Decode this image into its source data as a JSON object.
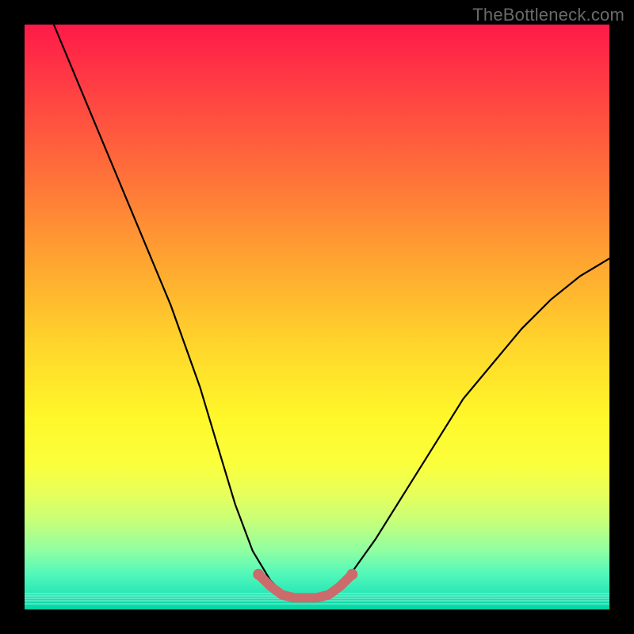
{
  "watermark": "TheBottleneck.com",
  "chart_data": {
    "type": "line",
    "title": "",
    "xlabel": "",
    "ylabel": "",
    "xlim": [
      0,
      100
    ],
    "ylim": [
      0,
      100
    ],
    "grid": false,
    "legend": "none",
    "series": [
      {
        "name": "bottleneck-curve",
        "color": "#000000",
        "x": [
          5,
          10,
          15,
          20,
          25,
          30,
          33,
          36,
          39,
          42,
          44,
          46,
          48,
          50,
          52,
          55,
          60,
          65,
          70,
          75,
          80,
          85,
          90,
          95,
          100
        ],
        "values": [
          100,
          88,
          76,
          64,
          52,
          38,
          28,
          18,
          10,
          5,
          3,
          2,
          2,
          2,
          3,
          5,
          12,
          20,
          28,
          36,
          42,
          48,
          53,
          57,
          60
        ]
      },
      {
        "name": "optimal-band-highlight",
        "color": "#cc6b6b",
        "x": [
          40,
          42,
          44,
          46,
          48,
          50,
          52,
          54,
          56
        ],
        "values": [
          6,
          4,
          2.5,
          2,
          2,
          2,
          2.5,
          4,
          6
        ]
      }
    ],
    "annotations": []
  },
  "colors": {
    "frame": "#000000",
    "curve": "#000000",
    "highlight": "#cc6b6b",
    "watermark": "#6a6a6a"
  }
}
